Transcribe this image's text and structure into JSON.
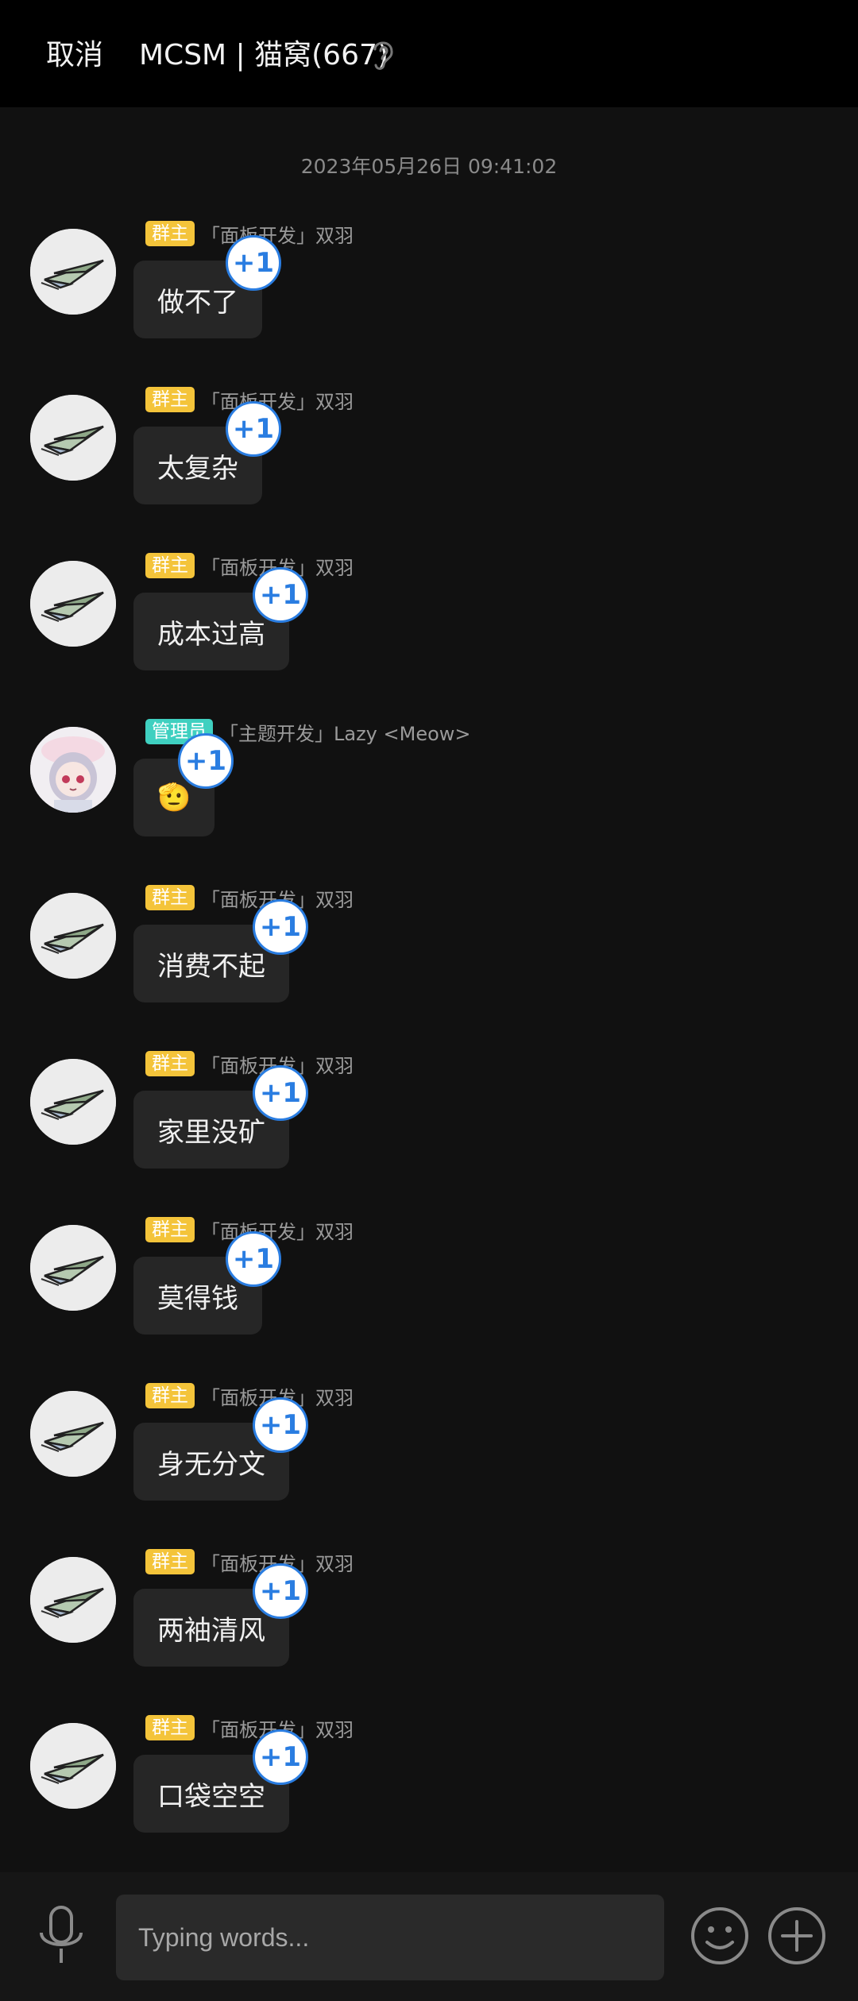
{
  "header": {
    "cancel_label": "取消",
    "title": "MCSM | 猫窝(667)",
    "ear_icon": "ear-icon"
  },
  "timestamp": "2023年05月26日 09:41:02",
  "messages": [
    {
      "role": "群主",
      "role_type": "owner",
      "sender": "「面板开发」双羽",
      "text": "做不了",
      "reaction": "+1"
    },
    {
      "role": "群主",
      "role_type": "owner",
      "sender": "「面板开发」双羽",
      "text": "太复杂",
      "reaction": "+1"
    },
    {
      "role": "群主",
      "role_type": "owner",
      "sender": "「面板开发」双羽",
      "text": "成本过高",
      "reaction": "+1"
    },
    {
      "role": "管理员",
      "role_type": "admin",
      "sender": "「主题开发」Lazy <Meow>",
      "text": "🫡",
      "reaction": "+1"
    },
    {
      "role": "群主",
      "role_type": "owner",
      "sender": "「面板开发」双羽",
      "text": "消费不起",
      "reaction": "+1"
    },
    {
      "role": "群主",
      "role_type": "owner",
      "sender": "「面板开发」双羽",
      "text": "家里没矿",
      "reaction": "+1"
    },
    {
      "role": "群主",
      "role_type": "owner",
      "sender": "「面板开发」双羽",
      "text": "莫得钱",
      "reaction": "+1"
    },
    {
      "role": "群主",
      "role_type": "owner",
      "sender": "「面板开发」双羽",
      "text": "身无分文",
      "reaction": "+1"
    },
    {
      "role": "群主",
      "role_type": "owner",
      "sender": "「面板开发」双羽",
      "text": "两袖清风",
      "reaction": "+1"
    },
    {
      "role": "群主",
      "role_type": "owner",
      "sender": "「面板开发」双羽",
      "text": "口袋空空",
      "reaction": "+1"
    }
  ],
  "composer": {
    "placeholder": "Typing words..."
  },
  "colors": {
    "background": "#111111",
    "topbar": "#000000",
    "bubble": "#262626",
    "owner_badge": "#f4c43a",
    "admin_badge": "#3fd0c0",
    "reaction_accent": "#2a7de1"
  }
}
